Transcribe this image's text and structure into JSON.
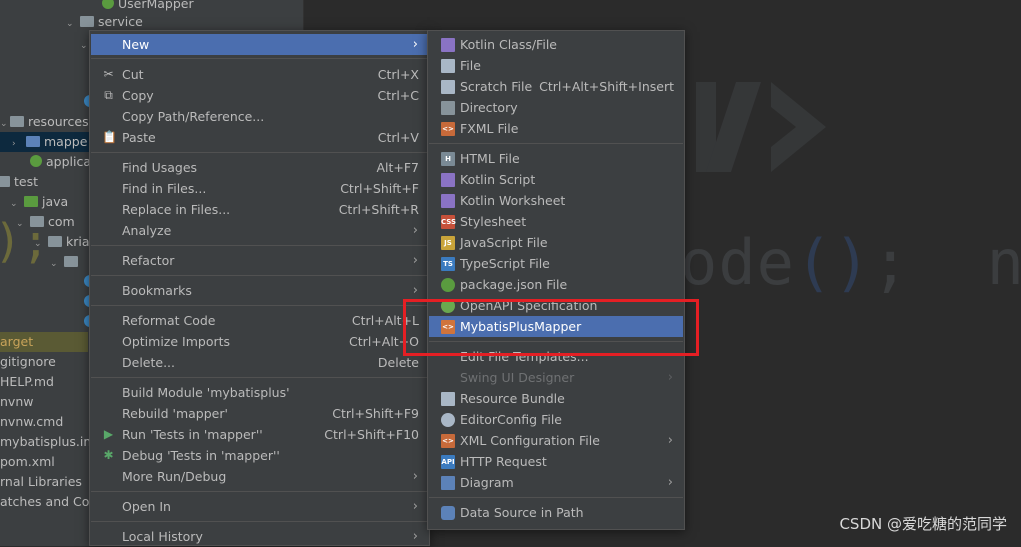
{
  "tree": {
    "rows": [
      {
        "label": "UserMapper",
        "indent": 3
      },
      {
        "label": "service",
        "indent": 2
      },
      {
        "label": "resources",
        "indent": 1
      },
      {
        "label": "mappe",
        "indent": 2
      },
      {
        "label": "applica",
        "indent": 2
      },
      {
        "label": "test",
        "indent": 0
      },
      {
        "label": "java",
        "indent": 1
      },
      {
        "label": "com",
        "indent": 2
      },
      {
        "label": "kria",
        "indent": 3
      },
      {
        "label": "arget",
        "indent": 0
      },
      {
        "label": "gitignore",
        "indent": 0
      },
      {
        "label": "HELP.md",
        "indent": 0
      },
      {
        "label": "nvnw",
        "indent": 0
      },
      {
        "label": "nvnw.cmd",
        "indent": 0
      },
      {
        "label": "mybatisplus.iml",
        "indent": 0
      },
      {
        "label": "pom.xml",
        "indent": 0
      },
      {
        "label": "rnal Libraries",
        "indent": 0
      },
      {
        "label": "atches and Cons",
        "indent": 0
      }
    ]
  },
  "editor": {
    "code_fragment": "ode();  n"
  },
  "context_menu": {
    "items": [
      {
        "label": "New",
        "arrow": true
      },
      {
        "label": "Cut",
        "shortcut": "Ctrl+X"
      },
      {
        "label": "Copy",
        "shortcut": "Ctrl+C"
      },
      {
        "label": "Copy Path/Reference..."
      },
      {
        "label": "Paste",
        "shortcut": "Ctrl+V"
      },
      {
        "label": "Find Usages",
        "shortcut": "Alt+F7"
      },
      {
        "label": "Find in Files...",
        "shortcut": "Ctrl+Shift+F"
      },
      {
        "label": "Replace in Files...",
        "shortcut": "Ctrl+Shift+R"
      },
      {
        "label": "Analyze",
        "arrow": true
      },
      {
        "label": "Refactor",
        "arrow": true
      },
      {
        "label": "Bookmarks",
        "arrow": true
      },
      {
        "label": "Reformat Code",
        "shortcut": "Ctrl+Alt+L"
      },
      {
        "label": "Optimize Imports",
        "shortcut": "Ctrl+Alt+O"
      },
      {
        "label": "Delete...",
        "shortcut": "Delete"
      },
      {
        "label": "Build Module 'mybatisplus'"
      },
      {
        "label": "Rebuild 'mapper'",
        "shortcut": "Ctrl+Shift+F9"
      },
      {
        "label": "Run 'Tests in 'mapper''",
        "shortcut": "Ctrl+Shift+F10"
      },
      {
        "label": "Debug 'Tests in 'mapper''"
      },
      {
        "label": "More Run/Debug",
        "arrow": true
      },
      {
        "label": "Open In",
        "arrow": true
      },
      {
        "label": "Local History",
        "arrow": true
      }
    ]
  },
  "new_submenu": {
    "items": [
      {
        "label": "Kotlin Class/File"
      },
      {
        "label": "File"
      },
      {
        "label": "Scratch File",
        "shortcut": "Ctrl+Alt+Shift+Insert"
      },
      {
        "label": "Directory"
      },
      {
        "label": "FXML File"
      },
      {
        "label": "HTML File"
      },
      {
        "label": "Kotlin Script"
      },
      {
        "label": "Kotlin Worksheet"
      },
      {
        "label": "Stylesheet"
      },
      {
        "label": "JavaScript File"
      },
      {
        "label": "TypeScript File"
      },
      {
        "label": "package.json File"
      },
      {
        "label": "OpenAPI Specification"
      },
      {
        "label": "MybatisPlusMapper"
      },
      {
        "label": "Edit File Templates..."
      },
      {
        "label": "Swing UI Designer",
        "arrow": true
      },
      {
        "label": "Resource Bundle"
      },
      {
        "label": "EditorConfig File"
      },
      {
        "label": "XML Configuration File",
        "arrow": true
      },
      {
        "label": "HTTP Request"
      },
      {
        "label": "Diagram",
        "arrow": true
      },
      {
        "label": "Data Source in Path"
      }
    ],
    "icon_badges": {
      "html": "H",
      "css": "CSS",
      "js": "JS",
      "ts": "TS",
      "api": "API",
      "xml": "<>",
      "fxml": "<>"
    }
  },
  "watermark": "CSDN @爱吃糖的范同学",
  "colors": {
    "highlight": "#4b6eaf",
    "menu_bg": "#3c3f41",
    "annotation_red": "#e51f24"
  }
}
